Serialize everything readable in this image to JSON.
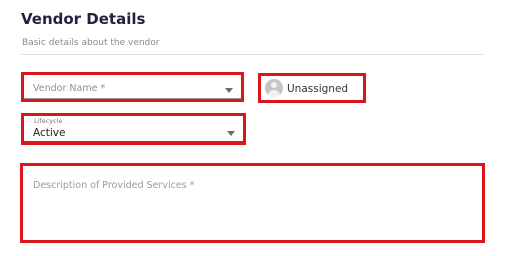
{
  "section": {
    "title": "Vendor Details",
    "subtitle": "Basic details about the vendor"
  },
  "fields": {
    "vendor_name": {
      "placeholder": "Vendor Name *"
    },
    "assignee": {
      "value": "Unassigned",
      "icon": "user-avatar-icon"
    },
    "lifecycle": {
      "label": "Lifecycle",
      "value": "Active"
    },
    "description": {
      "placeholder": "Description of Provided Services *"
    }
  },
  "colors": {
    "highlight": "#d9161b",
    "title": "#1f2340"
  }
}
